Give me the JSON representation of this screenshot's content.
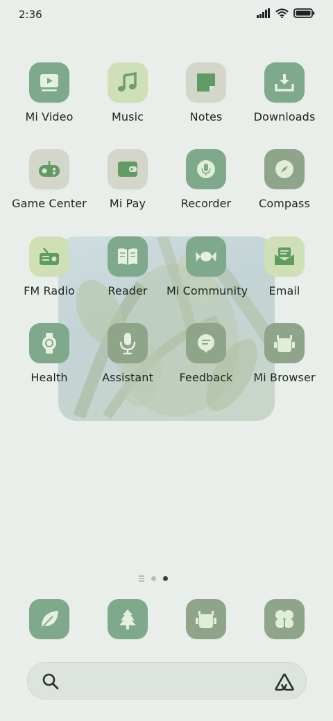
{
  "status_bar": {
    "time": "2:36",
    "icons": [
      "signal-icon",
      "wifi-icon",
      "battery-icon"
    ]
  },
  "apps": [
    {
      "label": "Mi Video",
      "icon": "play-video-icon"
    },
    {
      "label": "Music",
      "icon": "music-note-icon"
    },
    {
      "label": "Notes",
      "icon": "note-icon"
    },
    {
      "label": "Downloads",
      "icon": "download-icon"
    },
    {
      "label": "Game Center",
      "icon": "gamepad-icon"
    },
    {
      "label": "Mi Pay",
      "icon": "wallet-icon"
    },
    {
      "label": "Recorder",
      "icon": "microphone-icon"
    },
    {
      "label": "Compass",
      "icon": "compass-icon"
    },
    {
      "label": "FM Radio",
      "icon": "radio-icon"
    },
    {
      "label": "Reader",
      "icon": "book-icon"
    },
    {
      "label": "Mi Community",
      "icon": "candy-icon"
    },
    {
      "label": "Email",
      "icon": "mail-icon"
    },
    {
      "label": "Health",
      "icon": "watch-icon"
    },
    {
      "label": "Assistant",
      "icon": "microphone-icon"
    },
    {
      "label": "Feedback",
      "icon": "chat-bubble-icon"
    },
    {
      "label": "Mi Browser",
      "icon": "robot-icon"
    }
  ],
  "dock": [
    {
      "icon": "leaf-icon"
    },
    {
      "icon": "tree-icon"
    },
    {
      "icon": "robot-icon"
    },
    {
      "icon": "clover-icon"
    }
  ],
  "page_indicator": {
    "pages": 2,
    "active": 2
  },
  "search": {
    "icons": [
      "search-icon",
      "assistant-icon"
    ]
  },
  "colors": {
    "background": "#e9eeea",
    "icon_green": "#7ea98a",
    "icon_sage": "#8ea58a",
    "icon_lime": "#cfe0b7",
    "icon_gray": "#d3d6c9"
  }
}
